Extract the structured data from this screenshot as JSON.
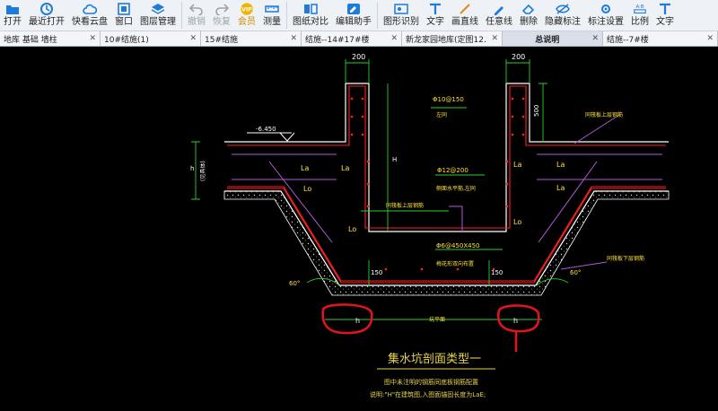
{
  "toolbar": {
    "items": [
      {
        "label": "打开",
        "icon": "folder-open-icon",
        "enabled": true
      },
      {
        "label": "最近打开",
        "icon": "clock-icon",
        "enabled": true
      },
      {
        "label": "快看云盘",
        "icon": "cloud-icon",
        "enabled": true
      },
      {
        "label": "窗口",
        "icon": "window-icon",
        "enabled": true
      },
      {
        "label": "图层管理",
        "icon": "layers-icon",
        "enabled": true
      },
      {
        "label": "撤销",
        "icon": "undo-icon",
        "enabled": false
      },
      {
        "label": "恢复",
        "icon": "redo-icon",
        "enabled": false
      },
      {
        "label": "会员",
        "icon": "vip-badge-icon",
        "enabled": true
      },
      {
        "label": "测量",
        "icon": "measure-icon",
        "enabled": true
      },
      {
        "label": "图纸对比",
        "icon": "compare-icon",
        "enabled": true
      },
      {
        "label": "编辑助手",
        "icon": "edit-assistant-icon",
        "enabled": true
      },
      {
        "label": "图形识别",
        "icon": "shape-recognize-icon",
        "enabled": true
      },
      {
        "label": "文字",
        "icon": "text-icon",
        "enabled": true
      },
      {
        "label": "画直线",
        "icon": "line-icon",
        "enabled": true
      },
      {
        "label": "任意线",
        "icon": "freehand-line-icon",
        "enabled": true
      },
      {
        "label": "删除",
        "icon": "eraser-icon",
        "enabled": true
      },
      {
        "label": "隐藏标注",
        "icon": "hide-annotation-icon",
        "enabled": true
      },
      {
        "label": "标注设置",
        "icon": "annotation-settings-icon",
        "enabled": true
      },
      {
        "label": "比例",
        "icon": "scale-icon",
        "enabled": true
      },
      {
        "label": "文字",
        "icon": "text-icon",
        "enabled": true
      }
    ]
  },
  "tabs": [
    {
      "label": "地库 基础 墙柱",
      "active": false
    },
    {
      "label": "10#结施(1)",
      "active": false
    },
    {
      "label": "15#结施",
      "active": false
    },
    {
      "label": "结施--14#17#楼",
      "active": false
    },
    {
      "label": "新龙家园地库(定图12…",
      "active": false
    },
    {
      "label": "总说明",
      "active": true
    },
    {
      "label": "结施--7#楼",
      "active": false
    }
  ],
  "drawing": {
    "dims": {
      "left_200": "200",
      "right_200": "200",
      "right_500": "500",
      "h_left": "h",
      "h_left_sub": "(见具体)",
      "H": "H",
      "elev": "-6.450",
      "d150a": "150",
      "d150b": "150",
      "h_ann1": "h",
      "h_ann2": "h"
    },
    "labels": {
      "la1": "La",
      "la2": "La",
      "la3": "La",
      "la4": "La",
      "lo1": "Lo",
      "lo2": "Lo",
      "lo3": "Lo",
      "la5": "La",
      "rebar1": "Φ10@150",
      "rebar1_sub": "左同",
      "rebar2": "Φ12@200",
      "rebar2_sub": "侧面水平筋,左同",
      "rebar3": "Φ6@450X450",
      "rebar3_sub": "梅花形双向布置",
      "top_bar": "同筏板上层钢筋",
      "top_bar2": "同筏板上层钢筋",
      "bot_bar": "同筏板下层钢筋",
      "ang_left": "60°",
      "ang_right": "60°",
      "floor": "坑平面"
    },
    "title": "集水坑剖面类型一",
    "note1": "图中未注明的钢筋同底板钢筋配置",
    "note2": "说明:\"H\"在建筑图,入图面锚固长度为LaE;"
  },
  "colors": {
    "accent": "#1e7bd7",
    "vip": "#f0b400",
    "concrete": "#ffffff",
    "rebar_red": "#ff2020",
    "dim_green": "#2bd12b",
    "purple": "#b05ad6",
    "markup_red": "#e0141e",
    "title_yellow": "#e8d44a",
    "bg": "#000000"
  }
}
